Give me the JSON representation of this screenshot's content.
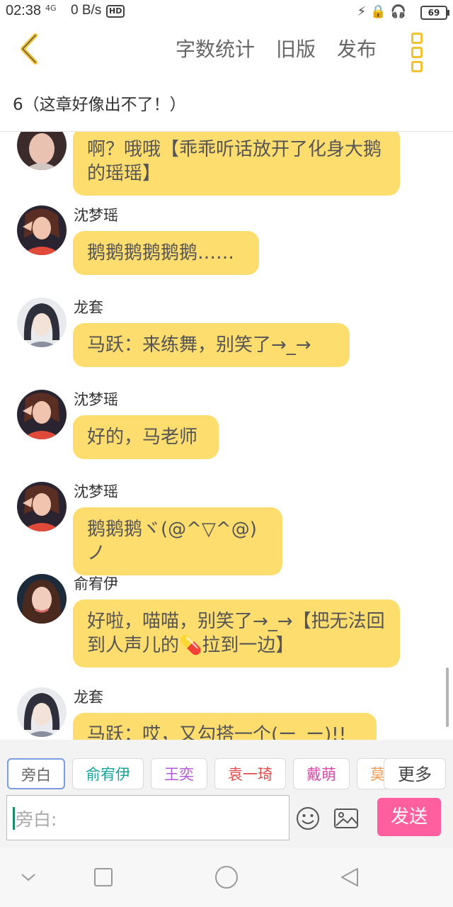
{
  "status_bar": {
    "time": "02:38",
    "network": "4G",
    "speed": "0 B/s",
    "hd": "HD",
    "battery": "69"
  },
  "header": {
    "back_icon": "chevron-left-icon",
    "actions": [
      "字数统计",
      "旧版",
      "发布"
    ],
    "more_icon": "more-vertical-icon",
    "accent": "#f2c230"
  },
  "chapter": {
    "title": "6（这章好像出不了！）"
  },
  "messages": [
    {
      "name": "",
      "avatar": "female-avatar",
      "text": "啊？哦哦【乖乖听话放开了化身大鹅的瑶瑶】"
    },
    {
      "name": "沈梦瑶",
      "avatar": "female-avatar",
      "text": "鹅鹅鹅鹅鹅鹅……"
    },
    {
      "name": "龙套",
      "avatar": "male-avatar",
      "text": "马跃：来练舞，别笑了→_→"
    },
    {
      "name": "沈梦瑶",
      "avatar": "female-avatar",
      "text": "好的，马老师"
    },
    {
      "name": "沈梦瑶",
      "avatar": "female-avatar",
      "text": "鹅鹅鹅ヾ(@^▽^@)ノ"
    },
    {
      "name": "俞宥伊",
      "avatar": "female-avatar",
      "text": "好啦，喵喵，别笑了→_→【把无法回到人声儿的💊拉到一边】"
    },
    {
      "name": "龙套",
      "avatar": "male-avatar",
      "text": "马跃：哎，又勾搭一个(ー_ー)!!"
    }
  ],
  "roles": [
    {
      "label": "旁白",
      "color": "#666666"
    },
    {
      "label": "俞宥伊",
      "color": "#1aa39a"
    },
    {
      "label": "王奕",
      "color": "#b257d6"
    },
    {
      "label": "袁一琦",
      "color": "#e14b4b"
    },
    {
      "label": "戴萌",
      "color": "#d94aa6"
    },
    {
      "label": "莫",
      "color": "#f09a54"
    }
  ],
  "more_label": "更多",
  "input": {
    "placeholder": "旁白:"
  },
  "send_label": "发送",
  "colors": {
    "bubble": "#fedd6f",
    "send": "#ff5f9f"
  }
}
